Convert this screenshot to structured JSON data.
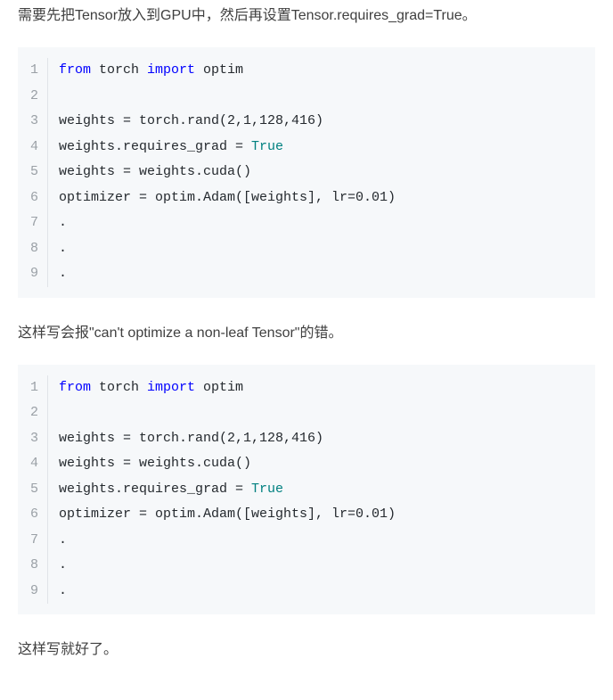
{
  "para1": "需要先把Tensor放入到GPU中，然后再设置Tensor.requires_grad=True。",
  "code1": {
    "lines": [
      [
        {
          "t": "from",
          "c": "kw"
        },
        {
          "t": " torch "
        },
        {
          "t": "import",
          "c": "kw"
        },
        {
          "t": " optim"
        }
      ],
      [],
      [
        {
          "t": "weights = torch.rand(2,1,128,416)"
        }
      ],
      [
        {
          "t": "weights.requires_grad = "
        },
        {
          "t": "True",
          "c": "bool"
        }
      ],
      [
        {
          "t": "weights = weights.cuda()"
        }
      ],
      [
        {
          "t": "optimizer = optim.Adam([weights], lr=0.01)"
        }
      ],
      [
        {
          "t": "."
        }
      ],
      [
        {
          "t": "."
        }
      ],
      [
        {
          "t": "."
        }
      ]
    ]
  },
  "para2": "这样写会报\"can't optimize a non-leaf Tensor\"的错。",
  "code2": {
    "lines": [
      [
        {
          "t": "from",
          "c": "kw"
        },
        {
          "t": " torch "
        },
        {
          "t": "import",
          "c": "kw"
        },
        {
          "t": " optim"
        }
      ],
      [],
      [
        {
          "t": "weights = torch.rand(2,1,128,416)"
        }
      ],
      [
        {
          "t": "weights = weights.cuda()"
        }
      ],
      [
        {
          "t": "weights.requires_grad = "
        },
        {
          "t": "True",
          "c": "bool"
        }
      ],
      [
        {
          "t": "optimizer = optim.Adam([weights], lr=0.01)"
        }
      ],
      [
        {
          "t": "."
        }
      ],
      [
        {
          "t": "."
        }
      ],
      [
        {
          "t": "."
        }
      ]
    ]
  },
  "para3": "这样写就好了。"
}
